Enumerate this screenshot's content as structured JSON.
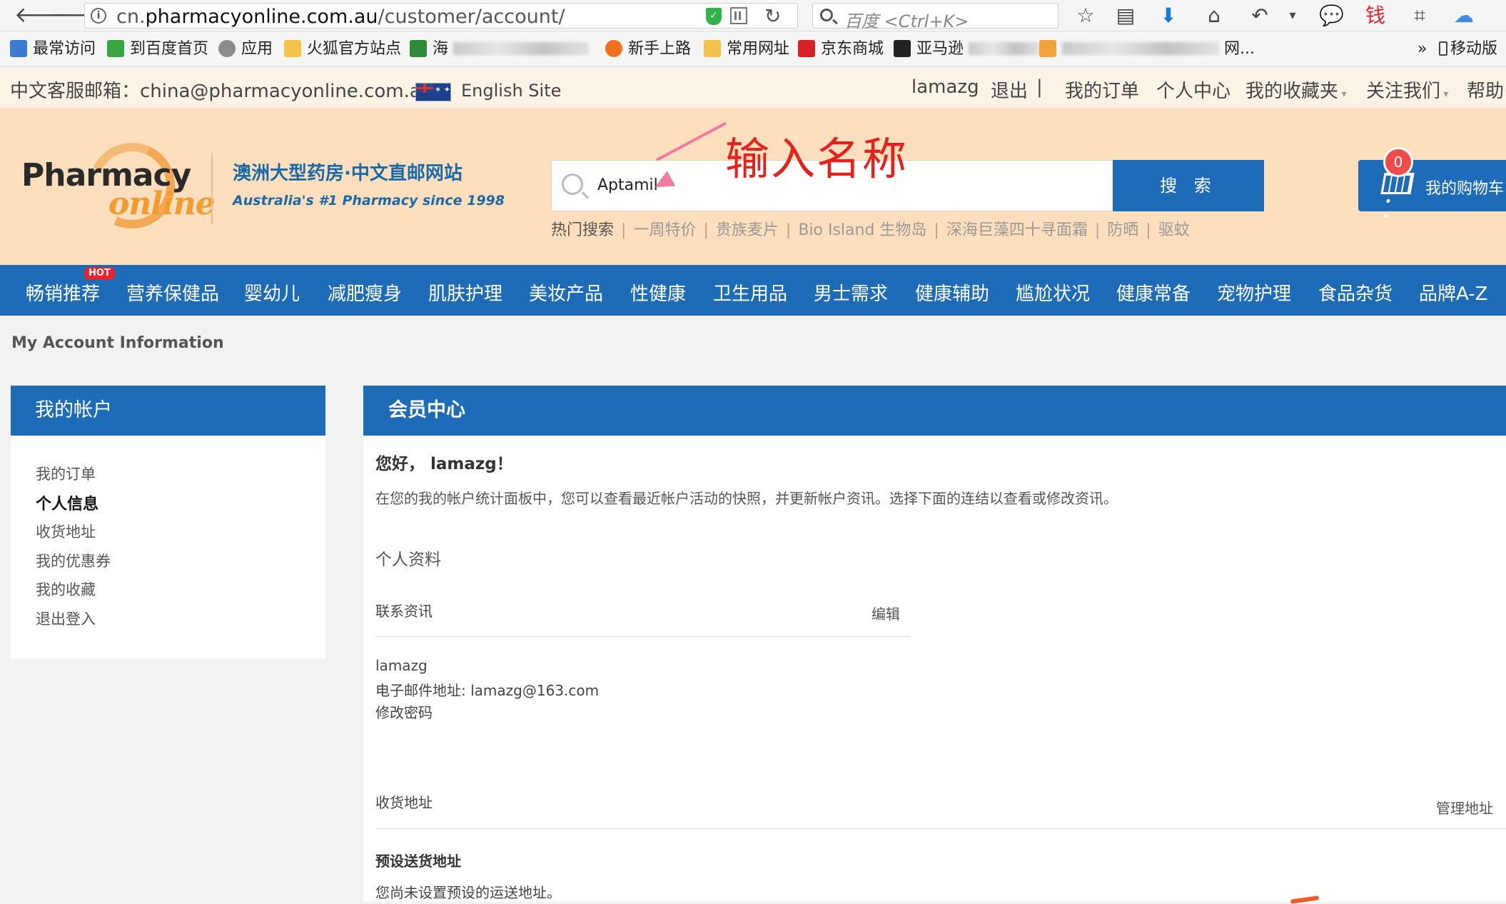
{
  "browser": {
    "url_prefix": "cn.",
    "url_domain": "pharmacyonline.com.au",
    "url_path": "/customer/account/",
    "search_placeholder": "百度 <Ctrl+K>",
    "bookmarks": [
      {
        "label": "最常访问",
        "color": "#3b7bd1"
      },
      {
        "label": "到百度首页",
        "color": "#3aa641"
      },
      {
        "label": "应用",
        "color": "#8c8c8c"
      },
      {
        "label": "火狐官方站点",
        "color": "#f2c24a"
      },
      {
        "label": "海",
        "color": "#2e8b3a"
      },
      {
        "label": "新手上路",
        "color": "#f37021"
      },
      {
        "label": "常用网址",
        "color": "#f2c24a"
      },
      {
        "label": "京东商城",
        "color": "#d71f28"
      },
      {
        "label": "亚马逊",
        "color": "#222222"
      },
      {
        "label": "网...",
        "color": "#f2a33a"
      }
    ],
    "overflow_label": "»",
    "mobile_label": "移动版"
  },
  "topbar": {
    "email_label": "中文客服邮箱：china@pharmacyonline.com.au",
    "english_site": "English Site",
    "username": "lamazg",
    "logout": "退出",
    "separator": "|",
    "orders": "我的订单",
    "center": "个人中心",
    "favorites": "我的收藏夹",
    "follow": "关注我们",
    "help": "帮助"
  },
  "header": {
    "logo_pharmacy": "Pharmacy",
    "logo_online": "online",
    "slogan_cn": "澳洲大型药房·中文直邮网站",
    "slogan_en": "Australia's #1 Pharmacy since 1998",
    "search_value": "Aptamil",
    "search_button": "搜 索",
    "hot_search_title": "热门搜索",
    "hot_items": [
      "一周特价",
      "贵族麦片",
      "Bio Island 生物岛",
      "深海巨藻四十寻面霜",
      "防晒",
      "驱蚊"
    ],
    "annotation": "输入名称",
    "cart_label": "我的购物车",
    "cart_count": "0"
  },
  "categories": {
    "hot_tag": "HOT",
    "items": [
      "畅销推荐",
      "营养保健品",
      "婴幼儿",
      "减肥瘦身",
      "肌肤护理",
      "美妆产品",
      "性健康",
      "卫生用品",
      "男士需求",
      "健康辅助",
      "尴尬状况",
      "健康常备",
      "宠物护理",
      "食品杂货",
      "品牌A-Z"
    ]
  },
  "page": {
    "heading": "My Account Information"
  },
  "sidebar": {
    "title": "我的帐户",
    "items": [
      "我的订单",
      "个人信息",
      "收货地址",
      "我的优惠券",
      "我的收藏",
      "退出登入"
    ]
  },
  "main": {
    "title": "会员中心",
    "greeting": "您好， lamazg！",
    "intro": "在您的我的帐户统计面板中，您可以查看最近帐户活动的快照，并更新帐户资讯。选择下面的连结以查看或修改资讯。",
    "profile_title": "个人资料",
    "contact_label": "联系资讯",
    "edit_link": "编辑",
    "name": "lamazg",
    "email_line": "电子邮件地址: lamazg@163.com",
    "change_password": "修改密码",
    "address_label": "收货地址",
    "manage_address": "管理地址",
    "default_address_label": "预设送货地址",
    "default_address_text": "您尚未设置预设的运送地址。"
  }
}
